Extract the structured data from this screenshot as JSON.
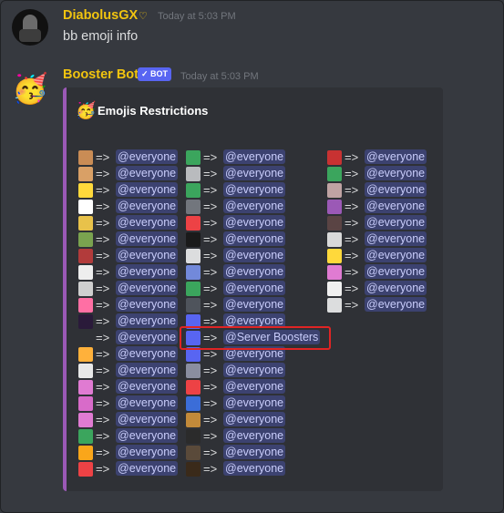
{
  "messages": [
    {
      "username": "DiabolusGX",
      "timestamp": "Today at 5:03 PM",
      "content": "bb emoji info",
      "badge_icon": "heart-outline-icon"
    },
    {
      "username": "Booster Bot",
      "bot_tag": "✓ BOT",
      "timestamp": "Today at 5:03 PM",
      "avatar_icon": "partying-face-icon"
    }
  ],
  "embed": {
    "accent_color": "#9b59b6",
    "title": "Emojis Restrictions",
    "title_icon": "partying-face-icon",
    "arrow": "=>",
    "columns": [
      [
        {
          "icon": "#c98c55",
          "label": "@everyone"
        },
        {
          "icon": "#d9a066",
          "label": "@everyone"
        },
        {
          "icon": "#ffd93b",
          "label": "@everyone"
        },
        {
          "icon": "#ffffff",
          "label": "@everyone"
        },
        {
          "icon": "#e8c24a",
          "label": "@everyone"
        },
        {
          "icon": "#7aa34f",
          "label": "@everyone"
        },
        {
          "icon": "#b23b3b",
          "label": "@everyone"
        },
        {
          "icon": "#eeeeee",
          "label": "@everyone"
        },
        {
          "icon": "#cfcfcf",
          "label": "@everyone"
        },
        {
          "icon": "#ff6fa4",
          "label": "@everyone"
        },
        {
          "icon": "#2a1a3a",
          "label": "@everyone"
        },
        {
          "icon": "",
          "label": "@everyone"
        },
        {
          "icon": "#ffb13b",
          "label": "@everyone"
        },
        {
          "icon": "#e8e8e8",
          "label": "@everyone"
        },
        {
          "icon": "#e07bd2",
          "label": "@everyone"
        },
        {
          "icon": "#d86bc9",
          "label": "@everyone"
        },
        {
          "icon": "#e07bd2",
          "label": "@everyone"
        },
        {
          "icon": "#3ba55d",
          "label": "@everyone"
        },
        {
          "icon": "#faa61a",
          "label": "@everyone"
        },
        {
          "icon": "#ed4245",
          "label": "@everyone"
        }
      ],
      [
        {
          "icon": "#3ba55d",
          "label": "@everyone"
        },
        {
          "icon": "#b9bbbe",
          "label": "@everyone"
        },
        {
          "icon": "#3ba55d",
          "label": "@everyone"
        },
        {
          "icon": "#72767d",
          "label": "@everyone"
        },
        {
          "icon": "#ed4245",
          "label": "@everyone"
        },
        {
          "icon": "#1a1a1a",
          "label": "@everyone"
        },
        {
          "icon": "#dcddde",
          "label": "@everyone"
        },
        {
          "icon": "#7289da",
          "label": "@everyone"
        },
        {
          "icon": "#3ba55d",
          "label": "@everyone"
        },
        {
          "icon": "#4f545c",
          "label": "@everyone"
        },
        {
          "icon": "#5865f2",
          "label": "@everyone"
        },
        {
          "icon": "#5865f2",
          "label": "@Server Boosters"
        },
        {
          "icon": "#5865f2",
          "label": "@everyone"
        },
        {
          "icon": "#8a8ea0",
          "label": "@everyone"
        },
        {
          "icon": "#ed4245",
          "label": "@everyone"
        },
        {
          "icon": "#3b6dd8",
          "label": "@everyone"
        },
        {
          "icon": "#c28a3a",
          "label": "@everyone"
        },
        {
          "icon": "#2b2b2b",
          "label": "@everyone"
        },
        {
          "icon": "#5a4a3a",
          "label": "@everyone"
        },
        {
          "icon": "#3a2a1a",
          "label": "@everyone"
        }
      ],
      [
        {
          "icon": "#c83232",
          "label": "@everyone"
        },
        {
          "icon": "#3ba55d",
          "label": "@everyone"
        },
        {
          "icon": "#bfa3a3",
          "label": "@everyone"
        },
        {
          "icon": "#9b59b6",
          "label": "@everyone"
        },
        {
          "icon": "#5a4444",
          "label": "@everyone"
        },
        {
          "icon": "#d9d9d9",
          "label": "@everyone"
        },
        {
          "icon": "#ffd93b",
          "label": "@everyone"
        },
        {
          "icon": "#e07bd2",
          "label": "@everyone"
        },
        {
          "icon": "#f0f0f0",
          "label": "@everyone"
        },
        {
          "icon": "#dcddde",
          "label": "@everyone"
        }
      ]
    ]
  },
  "highlight_row": "@Server Boosters"
}
